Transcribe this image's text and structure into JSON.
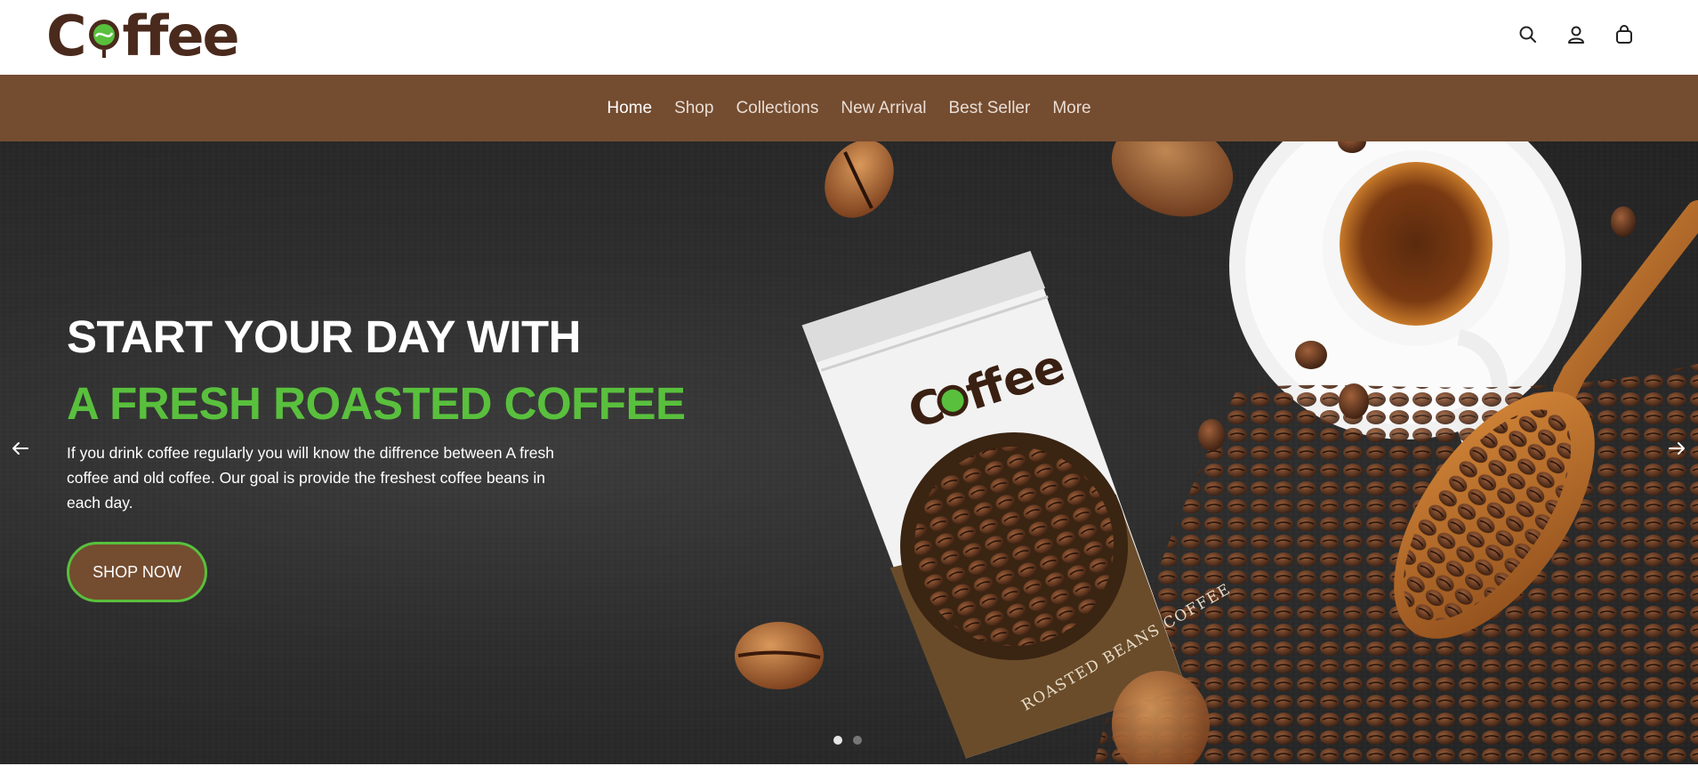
{
  "brand": {
    "logo_text_start": "C",
    "logo_text_end": "ffee",
    "accent_green": "#59c03d",
    "brown": "#744c30",
    "dark_brown": "#4a2a1c"
  },
  "header": {
    "icons": [
      "search-icon",
      "account-icon",
      "cart-icon"
    ]
  },
  "nav": {
    "items": [
      {
        "label": "Home",
        "active": true
      },
      {
        "label": "Shop",
        "active": false
      },
      {
        "label": "Collections",
        "active": false
      },
      {
        "label": "New Arrival",
        "active": false
      },
      {
        "label": "Best Seller",
        "active": false
      },
      {
        "label": "More",
        "active": false
      }
    ]
  },
  "hero": {
    "title_line1": "START YOUR DAY WITH",
    "title_line2": "A FRESH ROASTED COFFEE",
    "description": "If you drink coffee regularly you will know the diffrence between A fresh coffee and old coffee. Our goal is provide the freshest coffee beans in each day.",
    "cta_label": "SHOP NOW",
    "bag_logo_start": "C",
    "bag_logo_end": "ffee",
    "bag_caption": "ROASTED BEANS COFFEE",
    "slides_total": 2,
    "slide_active": 1
  }
}
